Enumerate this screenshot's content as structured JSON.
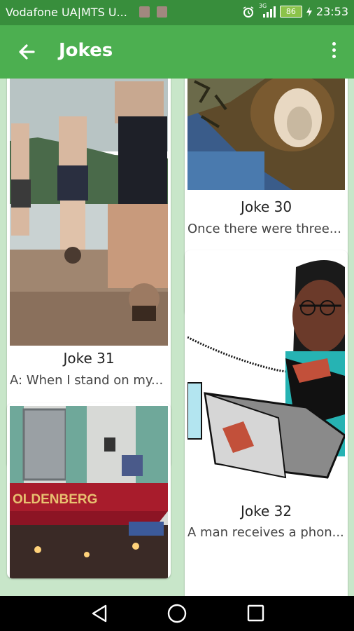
{
  "status_bar": {
    "carrier": "Vodafone UA|MTS U...",
    "network_type": "3G",
    "battery": "86",
    "time": "23:53"
  },
  "app_bar": {
    "title": "Jokes",
    "back_icon": "arrow-back-icon",
    "more_icon": "more-vert-icon"
  },
  "cards": {
    "joke31": {
      "title": "Joke 31",
      "preview": "A: When I stand on my..."
    },
    "joke30": {
      "title": "Joke 30",
      "preview": "Once there were three..."
    },
    "joke32": {
      "title": "Joke 32",
      "preview": "A man receives a phon..."
    },
    "joke33": {
      "sign_text": "OLDENBERG"
    }
  },
  "colors": {
    "status_bar": "#388e3c",
    "app_bar": "#4caf50",
    "background": "#c8e6c9",
    "nav_bar": "#000000"
  }
}
